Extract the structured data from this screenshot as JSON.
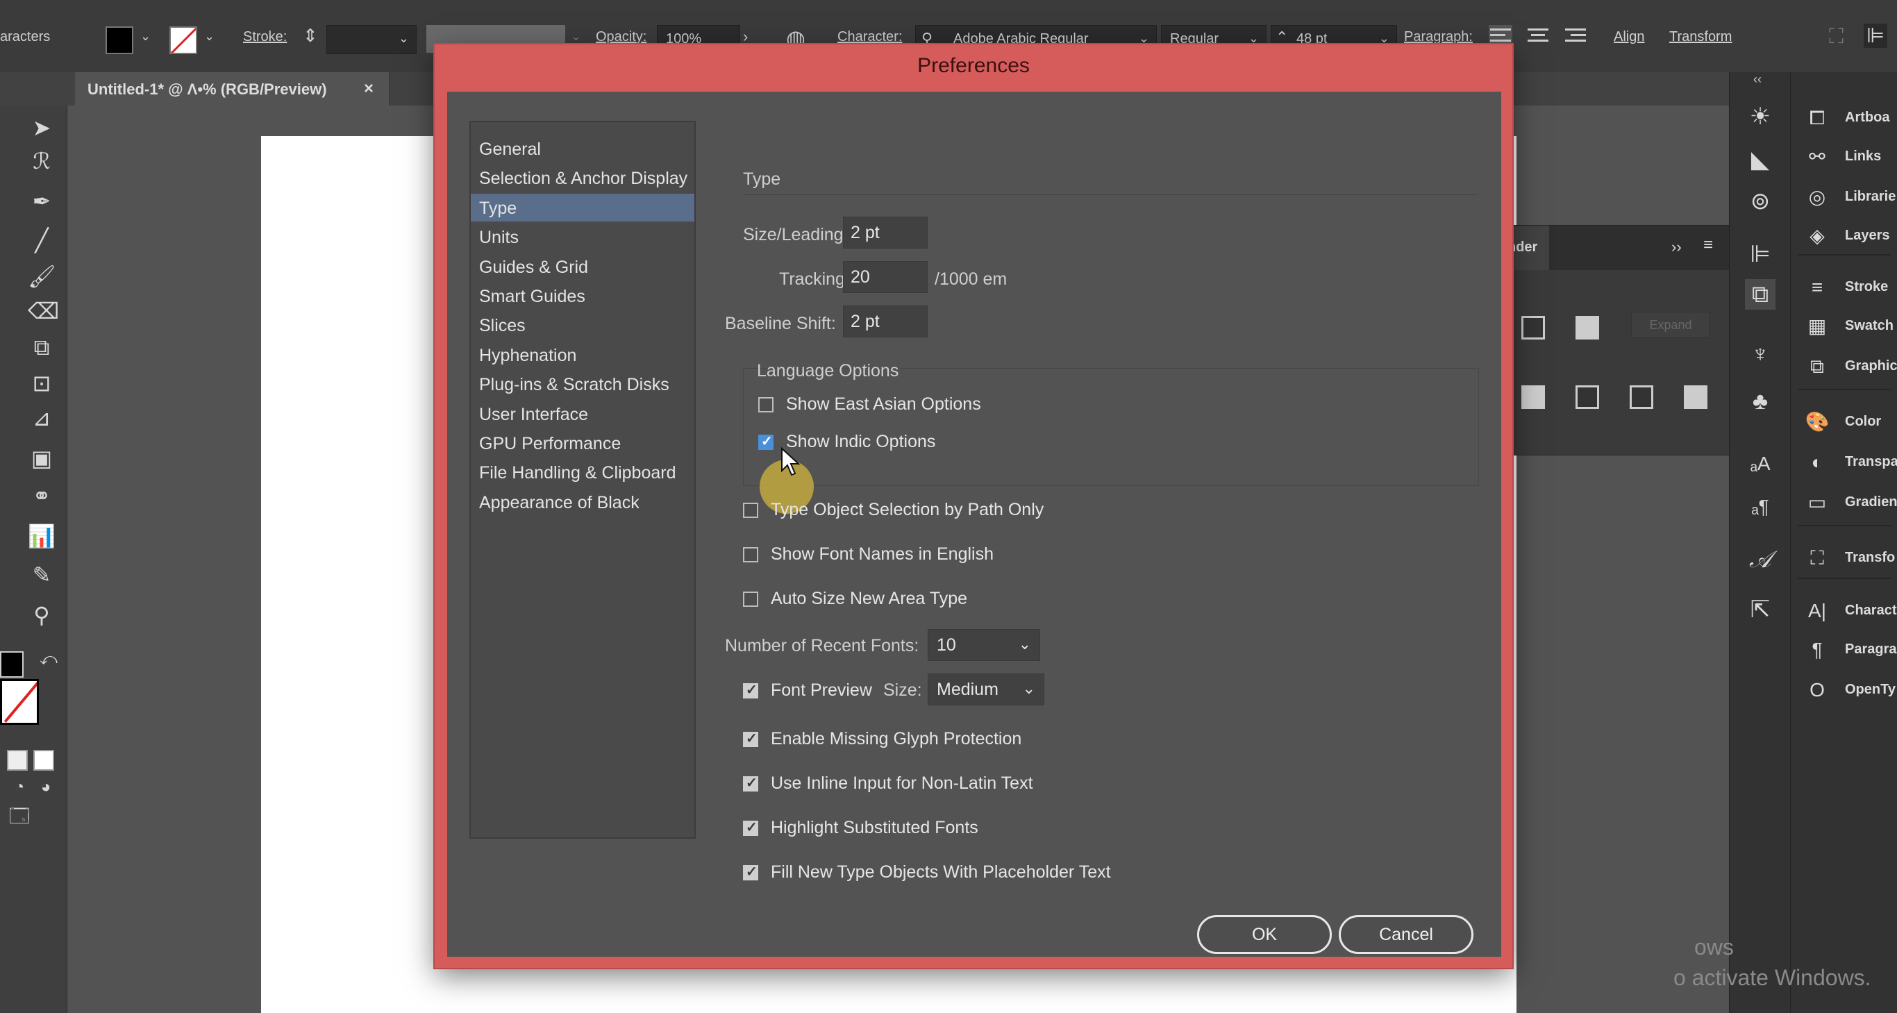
{
  "control_bar": {
    "characters_label": "aracters",
    "stroke_label": "Stroke:",
    "opacity_label": "Opacity:",
    "opacity_value": "100%",
    "character_label": "Character:",
    "font_name": "Adobe Arabic Regular",
    "font_style": "Regular",
    "font_size": "48 pt",
    "paragraph_label": "Paragraph:",
    "align_label": "Align",
    "transform_label": "Transform"
  },
  "document_tab": {
    "title": "Untitled-1* @ Λ•% (RGB/Preview)",
    "close": "×"
  },
  "floating_panel": {
    "tab_label": "nder",
    "expand_label": "Expand"
  },
  "right_dock": {
    "items": [
      {
        "label": "Artboa",
        "icon": "artboards-icon"
      },
      {
        "label": "Links",
        "icon": "links-icon"
      },
      {
        "label": "Librarie",
        "icon": "libraries-icon"
      },
      {
        "label": "Layers",
        "icon": "layers-icon"
      },
      {
        "label": "Stroke",
        "icon": "stroke-icon"
      },
      {
        "label": "Swatch",
        "icon": "swatches-icon"
      },
      {
        "label": "Graphic",
        "icon": "graphic-styles-icon"
      },
      {
        "label": "Color",
        "icon": "color-icon"
      },
      {
        "label": "Transpa",
        "icon": "transparency-icon"
      },
      {
        "label": "Gradien",
        "icon": "gradient-icon"
      },
      {
        "label": "Transfo",
        "icon": "transform-icon"
      },
      {
        "label": "Charact",
        "icon": "character-icon"
      },
      {
        "label": "Paragra",
        "icon": "paragraph-icon"
      },
      {
        "label": "OpenTy",
        "icon": "opentype-icon"
      }
    ]
  },
  "watermark": {
    "line1": "ows",
    "line2": "o activate Windows."
  },
  "dialog": {
    "title": "Preferences",
    "nav": [
      "General",
      "Selection & Anchor Display",
      "Type",
      "Units",
      "Guides & Grid",
      "Smart Guides",
      "Slices",
      "Hyphenation",
      "Plug-ins & Scratch Disks",
      "User Interface",
      "GPU Performance",
      "File Handling & Clipboard",
      "Appearance of Black"
    ],
    "active_nav": "Type",
    "section_title": "Type",
    "size_leading_label": "Size/Leading:",
    "size_leading_value": "2 pt",
    "tracking_label": "Tracking:",
    "tracking_value": "20",
    "tracking_unit": "/1000 em",
    "baseline_label": "Baseline Shift:",
    "baseline_value": "2 pt",
    "language_options_label": "Language Options",
    "show_east_asian": "Show East Asian Options",
    "show_indic": "Show Indic Options",
    "type_object_selection": "Type Object Selection by Path Only",
    "show_font_names_english": "Show Font Names in English",
    "auto_size_area_type": "Auto Size New Area Type",
    "recent_fonts_label": "Number of Recent Fonts:",
    "recent_fonts_value": "10",
    "font_preview": "Font Preview",
    "size_label": "Size:",
    "size_value": "Medium",
    "missing_glyph": "Enable Missing Glyph Protection",
    "inline_input": "Use Inline Input for Non-Latin Text",
    "highlight_substituted": "Highlight Substituted Fonts",
    "placeholder_text": "Fill New Type Objects With Placeholder Text",
    "ok": "OK",
    "cancel": "Cancel"
  }
}
